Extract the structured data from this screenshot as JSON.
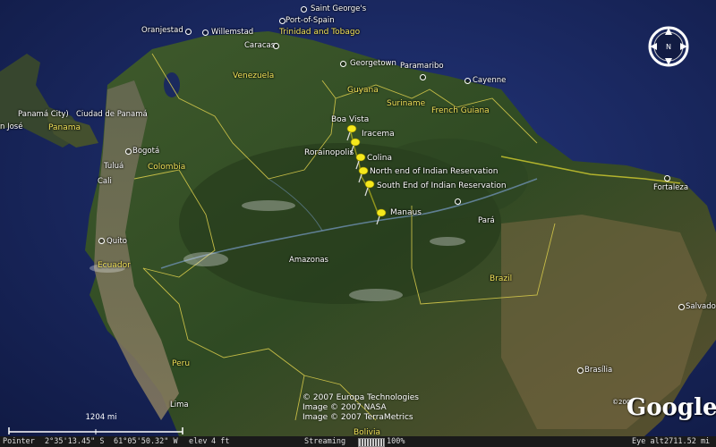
{
  "map": {
    "countries": [
      {
        "key": "venezuela",
        "name": "Venezuela"
      },
      {
        "key": "colombia",
        "name": "Colombia"
      },
      {
        "key": "guyana",
        "name": "Guyana"
      },
      {
        "key": "suriname",
        "name": "Suriname"
      },
      {
        "key": "french_guiana",
        "name": "French Guiana"
      },
      {
        "key": "ecuador",
        "name": "Ecuador"
      },
      {
        "key": "peru",
        "name": "Peru"
      },
      {
        "key": "brazil",
        "name": "Brazil"
      },
      {
        "key": "bolivia",
        "name": "Bolivia"
      },
      {
        "key": "trinidad",
        "name": "Trinidad and Tobago"
      },
      {
        "key": "panama",
        "name": "Panama"
      }
    ],
    "regions": [
      {
        "key": "amazonas",
        "name": "Amazonas"
      },
      {
        "key": "para",
        "name": "Pará"
      }
    ],
    "cities": [
      {
        "key": "saint_georges",
        "name": "Saint George's"
      },
      {
        "key": "oranjestad",
        "name": "Oranjestad"
      },
      {
        "key": "willemstad",
        "name": "Willemstad"
      },
      {
        "key": "port_of_spain",
        "name": "Port-of-Spain"
      },
      {
        "key": "caracas",
        "name": "Caracas"
      },
      {
        "key": "georgetown",
        "name": "Georgetown"
      },
      {
        "key": "paramaribo",
        "name": "Paramaribo"
      },
      {
        "key": "cayenne",
        "name": "Cayenne"
      },
      {
        "key": "panama_city",
        "name": "Panamá City)"
      },
      {
        "key": "ciudad_panama",
        "name": "Ciudad de Panamá"
      },
      {
        "key": "jose",
        "name": "n José"
      },
      {
        "key": "bogota",
        "name": "Bogotá"
      },
      {
        "key": "tulua",
        "name": "Tuluá"
      },
      {
        "key": "cali",
        "name": "Cali"
      },
      {
        "key": "quito",
        "name": "Quito"
      },
      {
        "key": "fortaleza",
        "name": "Fortaleza"
      },
      {
        "key": "salvador",
        "name": "Salvado"
      },
      {
        "key": "brasilia",
        "name": "Brasília"
      },
      {
        "key": "lima",
        "name": "Lima"
      }
    ],
    "placemarks": [
      {
        "key": "boa_vista",
        "name": "Boa Vista"
      },
      {
        "key": "iracema",
        "name": "Iracema"
      },
      {
        "key": "rorainopolis",
        "name": "Rorainopolis"
      },
      {
        "key": "colina",
        "name": "Colina"
      },
      {
        "key": "north_end",
        "name": "North end of Indian Reservation"
      },
      {
        "key": "south_end",
        "name": "South End of Indian Reservation"
      },
      {
        "key": "manaus",
        "name": "Manaus"
      }
    ]
  },
  "credits": {
    "line1": "© 2007 Europa Technologies",
    "line2": "Image © 2007 NASA",
    "line3": "Image © 2007 TerraMetrics"
  },
  "logo": {
    "text": "Google",
    "tm": "™"
  },
  "overlay_year": "©2007",
  "scale": {
    "label": "1204 mi"
  },
  "status": {
    "pointer_label": "Pointer",
    "lat": "2°35'13.45\" S",
    "lon": "61°05'50.32\" W",
    "elev_label": "elev",
    "elev": "4 ft",
    "streaming_label": "Streaming",
    "streaming_value": "100%",
    "streaming_fraction": 1.0,
    "eye_label": "Eye alt",
    "eye_value": "2711.52 mi"
  },
  "compass": {
    "north": "N"
  },
  "colors": {
    "label_yellow": "#f2e35a",
    "placemark": "#f5e81c",
    "ocean": "#1b2a5e"
  }
}
